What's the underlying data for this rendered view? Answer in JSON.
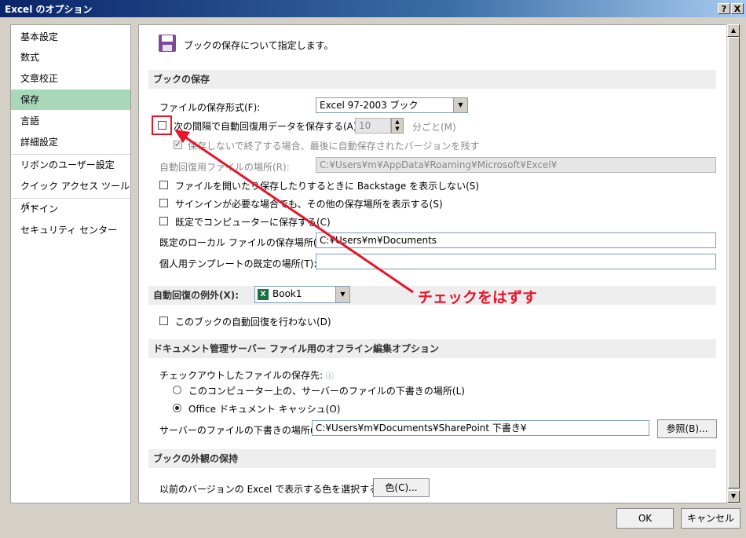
{
  "window": {
    "title": "Excel のオプション",
    "help": "?",
    "close": "X"
  },
  "sidebar": {
    "items": [
      "基本設定",
      "数式",
      "文章校正",
      "保存",
      "言語",
      "詳細設定",
      "リボンのユーザー設定",
      "クイック アクセス ツール バー",
      "アドイン",
      "セキュリティ センター"
    ],
    "active_index": 3
  },
  "header": {
    "text": "ブックの保存について指定します。",
    "icon": "floppy-disk-icon",
    "icon_color": "#7a4a9a"
  },
  "sections": {
    "book_save": {
      "title": "ブックの保存",
      "format_label": "ファイルの保存形式(F):",
      "format_value": "Excel 97-2003 ブック",
      "autorecover_label": "次の間隔で自動回復用データを保存する(A):",
      "autorecover_minutes": "10",
      "minutes_suffix": "分ごと(M)",
      "keep_last_label": "保存しないで終了する場合、最後に自動保存されたバージョンを残す",
      "autorecover_path_label": "自動回復用ファイルの場所(R):",
      "autorecover_path": "C:¥Users¥m¥AppData¥Roaming¥Microsoft¥Excel¥",
      "backstage_label": "ファイルを開いたり保存したりするときに Backstage を表示しない(S)",
      "show_other_label": "サインインが必要な場合でも、その他の保存場所を表示する(S)",
      "default_pc_label": "既定でコンピューターに保存する(C)",
      "local_path_label": "既定のローカル ファイルの保存場所(I):",
      "local_path": "C:¥Users¥m¥Documents",
      "template_label": "個人用テンプレートの既定の場所(T):",
      "template_path": ""
    },
    "exceptions": {
      "title": "自動回復の例外(X):",
      "book": "Book1",
      "disable_label": "このブックの自動回復を行わない(D)"
    },
    "offline": {
      "title": "ドキュメント管理サーバー ファイル用のオフライン編集オプション",
      "checkout_label": "チェックアウトしたファイルの保存先:",
      "radio1": "このコンピューター上の、サーバーのファイルの下書きの場所(L)",
      "radio2": "Office ドキュメント キャッシュ(O)",
      "drafts_label": "サーバーのファイルの下書きの場所(V):",
      "drafts_path": "C:¥Users¥m¥Documents¥SharePoint 下書き¥",
      "browse": "参照(B)..."
    },
    "appearance": {
      "title": "ブックの外観の保持",
      "colors_label": "以前のバージョンの Excel で表示する色を選択する:",
      "colors_button": "色(C)..."
    }
  },
  "footer": {
    "ok": "OK",
    "cancel": "キャンセル"
  },
  "annotation": {
    "text": "チェックをはずす",
    "color": "#e8142a"
  }
}
